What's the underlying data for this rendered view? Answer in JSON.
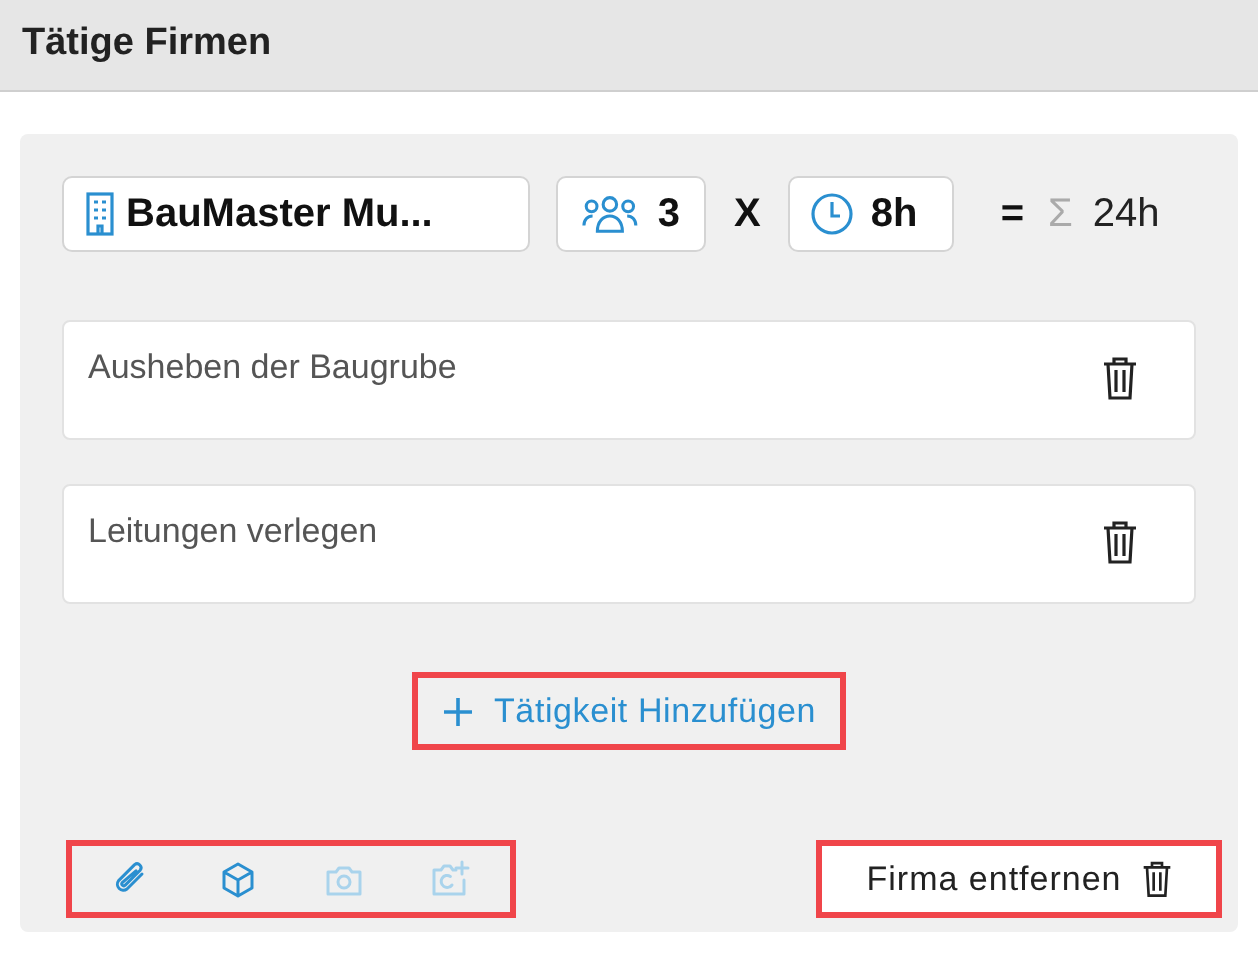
{
  "header": {
    "title": "Tätige Firmen"
  },
  "company": {
    "name": "BauMaster Mu...",
    "workers": "3",
    "times": "X",
    "hours": "8h",
    "equals": "=",
    "sigma": "Σ",
    "total": "24h"
  },
  "activities": [
    {
      "text": "Ausheben der Baugrube"
    },
    {
      "text": "Leitungen verlegen"
    }
  ],
  "add_activity": {
    "label": "Tätigkeit Hinzufügen",
    "highlighted": true
  },
  "tools": {
    "highlighted": true,
    "items": [
      {
        "kind": "attach",
        "disabled": false
      },
      {
        "kind": "cube",
        "disabled": false
      },
      {
        "kind": "camera",
        "disabled": true
      },
      {
        "kind": "camera-add",
        "disabled": true
      }
    ]
  },
  "remove_company": {
    "label": "Firma entfernen",
    "highlighted": true
  }
}
